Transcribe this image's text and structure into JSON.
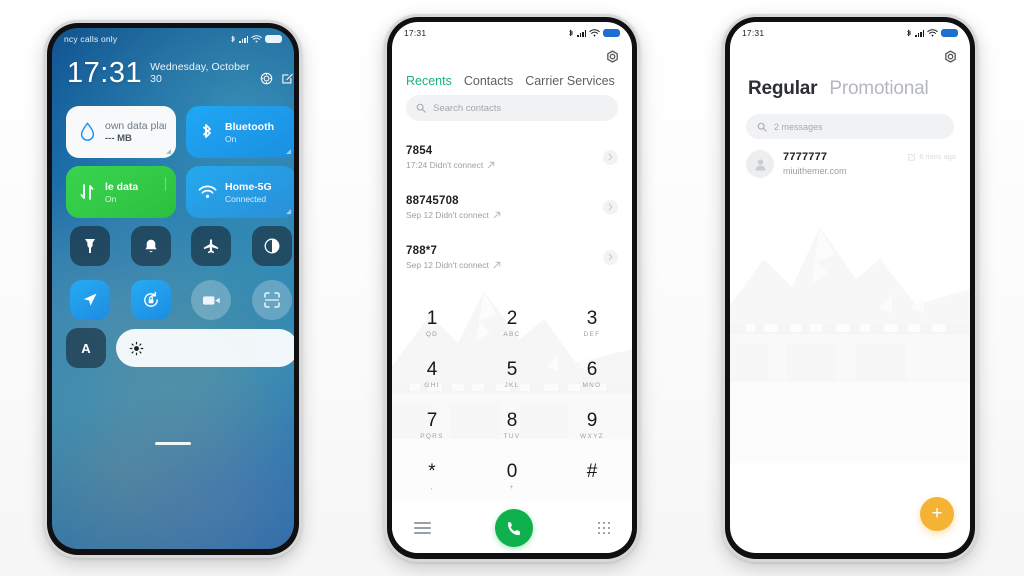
{
  "phone1": {
    "status": {
      "left_text": "ncy calls only",
      "icons": [
        "bluetooth-icon",
        "signal-icon",
        "wifi-icon",
        "battery-icon"
      ]
    },
    "clock": {
      "time": "17:31",
      "date": "Wednesday, October 30"
    },
    "clock_icons": [
      "settings-gear-icon",
      "edit-icon"
    ],
    "big_tiles": [
      {
        "title": "own data plan",
        "subtitle": "--- MB",
        "icon": "data-drop-icon",
        "style": "white"
      },
      {
        "title": "Bluetooth",
        "subtitle": "On",
        "icon": "bluetooth-icon",
        "style": "blue"
      },
      {
        "title": "le data",
        "subtitle": "On",
        "icon": "data-arrows-icon",
        "style": "green"
      },
      {
        "title": "Home-5G",
        "subtitle": "Connected",
        "icon": "wifi-icon",
        "style": "blue2"
      }
    ],
    "small_tiles": [
      {
        "name": "flashlight-icon",
        "style": "dark"
      },
      {
        "name": "ringer-bell-icon",
        "style": "dark"
      },
      {
        "name": "airplane-mode-icon",
        "style": "dark"
      },
      {
        "name": "dark-mode-icon",
        "style": "dark"
      },
      {
        "name": "location-icon",
        "style": "blue"
      },
      {
        "name": "auto-rotate-lock-icon",
        "style": "blue"
      },
      {
        "name": "screen-record-icon",
        "style": "ghost"
      },
      {
        "name": "scanner-icon",
        "style": "ghost"
      }
    ],
    "brightness": {
      "auto_label": "A",
      "icon": "brightness-sun-icon"
    }
  },
  "phone2": {
    "status": {
      "left_text": "17:31"
    },
    "settings_icon": "settings-gear-icon",
    "tabs": [
      {
        "label": "Recents",
        "active": true
      },
      {
        "label": "Contacts",
        "active": false
      },
      {
        "label": "Carrier Services",
        "active": false
      }
    ],
    "search": {
      "placeholder": "Search contacts",
      "icon": "search-icon"
    },
    "calls": [
      {
        "number": "7854",
        "meta": "17:24 Didn't connect"
      },
      {
        "number": "88745708",
        "meta": "Sep 12 Didn't connect"
      },
      {
        "number": "788*7",
        "meta": "Sep 12 Didn't connect"
      }
    ],
    "dialpad": [
      {
        "digit": "1",
        "letters": "QD"
      },
      {
        "digit": "2",
        "letters": "ABC"
      },
      {
        "digit": "3",
        "letters": "DEF"
      },
      {
        "digit": "4",
        "letters": "GHI"
      },
      {
        "digit": "5",
        "letters": "JKL"
      },
      {
        "digit": "6",
        "letters": "MNO"
      },
      {
        "digit": "7",
        "letters": "PQRS"
      },
      {
        "digit": "8",
        "letters": "TUV"
      },
      {
        "digit": "9",
        "letters": "WXYZ"
      },
      {
        "digit": "*",
        "letters": ","
      },
      {
        "digit": "0",
        "letters": "+"
      },
      {
        "digit": "#",
        "letters": ""
      }
    ],
    "bottom": {
      "menu_icon": "hamburger-menu-icon",
      "call_icon": "call-phone-icon",
      "keypad_icon": "keypad-grid-icon",
      "call_color": "#0fb14d"
    }
  },
  "phone3": {
    "status": {
      "left_text": "17:31"
    },
    "settings_icon": "settings-gear-icon",
    "tabs": [
      {
        "label": "Regular",
        "active": true
      },
      {
        "label": "Promotional",
        "active": false
      }
    ],
    "search": {
      "placeholder": "2 messages",
      "icon": "search-icon"
    },
    "messages": [
      {
        "sender": "7777777",
        "preview": "miuithemer.com",
        "time": "6 mins ago",
        "icon": "avatar-person-icon"
      }
    ],
    "fab": {
      "label": "+",
      "icon": "new-message-icon",
      "color": "#f5b335"
    }
  }
}
